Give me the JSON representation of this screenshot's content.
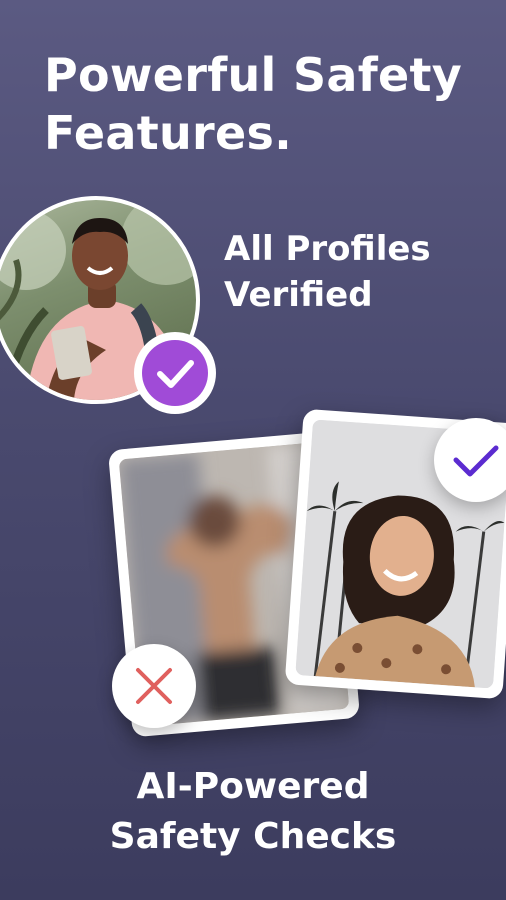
{
  "headline": {
    "line1": "Powerful Safety",
    "line2": "Features."
  },
  "verified": {
    "line1": "All Profiles",
    "line2": "Verified"
  },
  "checks": {
    "line1": "AI-Powered",
    "line2": "Safety Checks"
  },
  "icons": {
    "verified_badge": "check-circle-icon",
    "reject_badge": "x-mark-icon",
    "approve_badge": "check-icon"
  },
  "colors": {
    "background_top": "#5b5a82",
    "background_bottom": "#3c3c5e",
    "verify_purple": "#a04bd7",
    "approve_check": "#5b2bd0",
    "reject_red": "#e0605e"
  }
}
